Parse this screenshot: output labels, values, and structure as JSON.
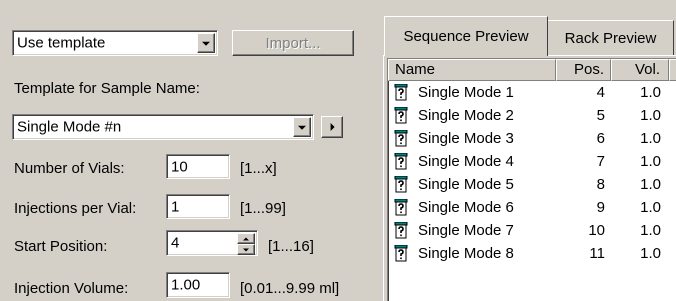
{
  "source_mode": {
    "value": "Use template"
  },
  "import_button": {
    "label": "Import..."
  },
  "template": {
    "label": "Template for Sample Name:",
    "value": "Single Mode #n"
  },
  "fields": {
    "vials": {
      "label": "Number of Vials:",
      "value": "10",
      "range": "[1...x]"
    },
    "injections": {
      "label": "Injections per Vial:",
      "value": "1",
      "range": "[1...99]"
    },
    "start": {
      "label": "Start Position:",
      "value": "4",
      "range": "[1...16]"
    },
    "volume": {
      "label": "Injection Volume:",
      "value": "1.00",
      "range": "[0.01...9.99 ml]"
    }
  },
  "tabs": [
    {
      "label": "Sequence Preview",
      "active": true
    },
    {
      "label": "Rack Preview",
      "active": false
    }
  ],
  "table": {
    "headers": [
      "Name",
      "Pos.",
      "Vol."
    ],
    "rows": [
      [
        "Single Mode 1",
        "4",
        "1.0"
      ],
      [
        "Single Mode 2",
        "5",
        "1.0"
      ],
      [
        "Single Mode 3",
        "6",
        "1.0"
      ],
      [
        "Single Mode 4",
        "7",
        "1.0"
      ],
      [
        "Single Mode 5",
        "8",
        "1.0"
      ],
      [
        "Single Mode 6",
        "9",
        "1.0"
      ],
      [
        "Single Mode 7",
        "10",
        "1.0"
      ],
      [
        "Single Mode 8",
        "11",
        "1.0"
      ]
    ]
  },
  "icons": {
    "row_icon": "vial-question-icon"
  },
  "colors": {
    "background": "#d4d0c8",
    "list_bg": "#ffffff",
    "icon_teal": "#008080"
  }
}
